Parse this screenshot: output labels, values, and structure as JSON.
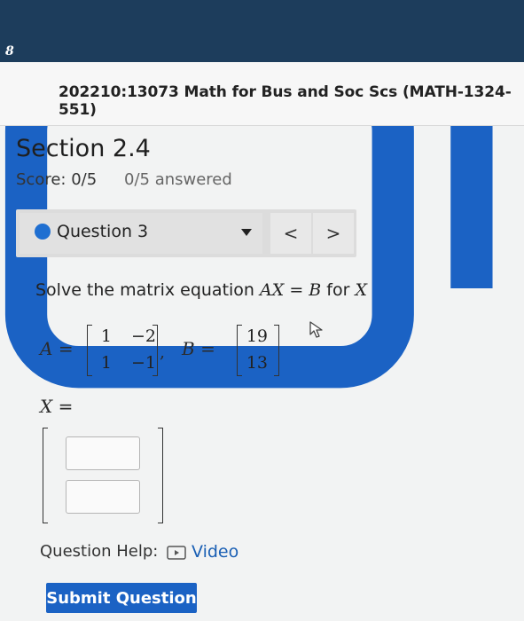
{
  "app": {
    "logo_glyph": "8"
  },
  "course": {
    "title": "202210:13073 Math for Bus and Soc Scs (MATH-1324-551)"
  },
  "section": {
    "title": "Section 2.4",
    "score": "Score: 0/5",
    "answered": "0/5 answered"
  },
  "question_nav": {
    "selected": "Question 3",
    "prev_glyph": "<",
    "next_glyph": ">"
  },
  "problem": {
    "prompt_text": "Solve the matrix equation",
    "equation_lhs": "AX",
    "equation_eq": "=",
    "equation_rhs": "B",
    "prompt_for": "for",
    "prompt_var": "X",
    "matrix_a_name": "A",
    "matrix_a": [
      [
        "1",
        "−2"
      ],
      [
        "1",
        "−1"
      ]
    ],
    "matrix_b_name": "B",
    "matrix_b": [
      [
        "19"
      ],
      [
        "13"
      ]
    ],
    "answer_label": "X =",
    "answer_var": "X",
    "answer_eq": "=",
    "answer_inputs": [
      "",
      ""
    ]
  },
  "help": {
    "label": "Question Help:",
    "video_label": "Video"
  },
  "submit": {
    "label": "Submit Question"
  },
  "colors": {
    "header": "#1d3d5c",
    "accent": "#1b62c4",
    "dot": "#1f6fd1"
  }
}
